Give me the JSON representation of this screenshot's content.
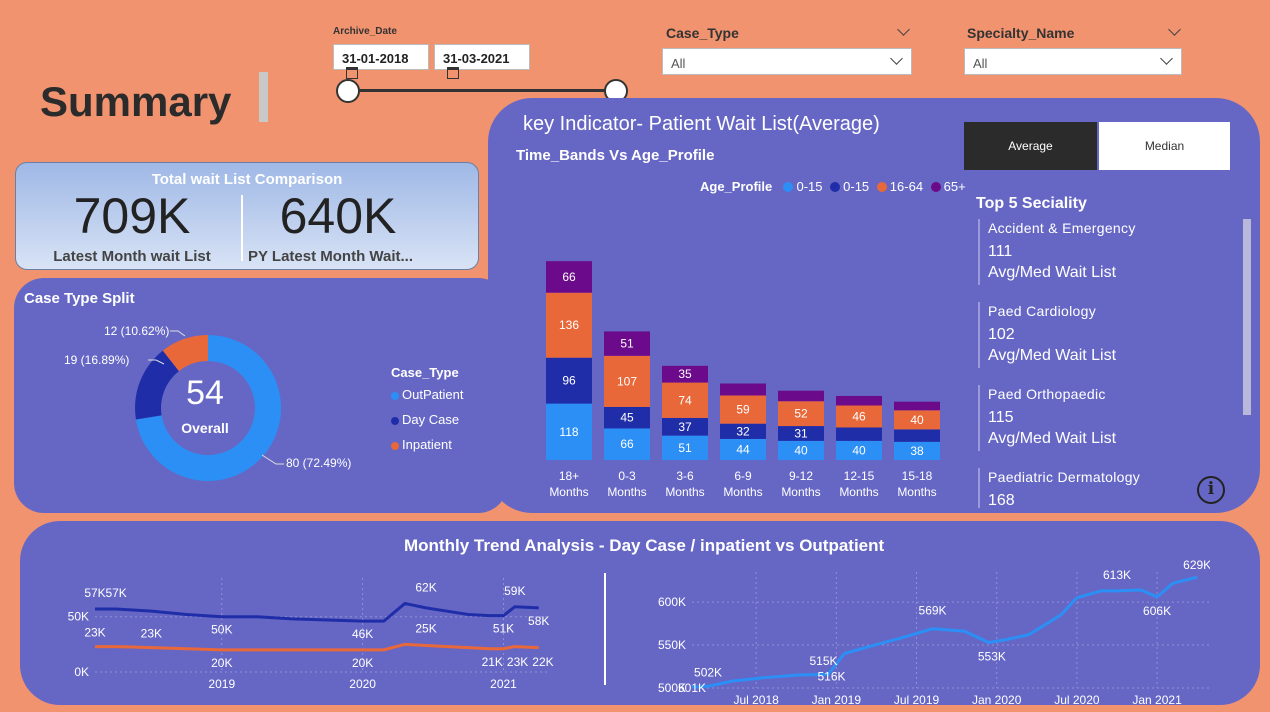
{
  "page_title": "Summary",
  "archive_date": {
    "label": "Archive_Date",
    "start": "31-01-2018",
    "end": "31-03-2021"
  },
  "case_type_filter": {
    "label": "Case_Type",
    "value": "All"
  },
  "specialty_filter": {
    "label": "Specialty_Name",
    "value": "All"
  },
  "wait_comparison": {
    "title": "Total wait List Comparison",
    "latest_value": "709K",
    "latest_label": "Latest Month wait List",
    "py_value": "640K",
    "py_label": "PY Latest Month Wait..."
  },
  "case_split": {
    "title": "Case Type Split",
    "center_value": "54",
    "center_label": "Overall",
    "legend_title": "Case_Type",
    "items": [
      {
        "name": "OutPatient",
        "color": "#2b8ff5",
        "pct": 72.49,
        "label": "80 (72.49%)"
      },
      {
        "name": "Day Case",
        "color": "#1f2ea8",
        "pct": 16.89,
        "label": "19 (16.89%)"
      },
      {
        "name": "Inpatient",
        "color": "#e8683a",
        "pct": 10.62,
        "label": "12 (10.62%)"
      }
    ]
  },
  "key_indicator": {
    "title": "key Indicator- Patient Wait List(Average)",
    "subtitle": "Time_Bands Vs Age_Profile"
  },
  "toggle": {
    "average": "Average",
    "median": "Median"
  },
  "top5": {
    "title": "Top 5 Seciality",
    "items": [
      {
        "name": "Accident & Emergency",
        "value": "111",
        "sub": "Avg/Med Wait List"
      },
      {
        "name": "Paed Cardiology",
        "value": "102",
        "sub": "Avg/Med Wait List"
      },
      {
        "name": "Paed Orthopaedic",
        "value": "115",
        "sub": "Avg/Med Wait List"
      },
      {
        "name": "Paediatric Dermatology",
        "value": "168",
        "sub": ""
      }
    ]
  },
  "trend": {
    "title": "Monthly Trend Analysis - Day Case / inpatient vs Outpatient"
  },
  "chart_data": [
    {
      "type": "bar",
      "title": "Time_Bands Vs Age_Profile",
      "legend_title": "Age_Profile",
      "categories": [
        "18+ Months",
        "0-3 Months",
        "3-6 Months",
        "6-9 Months",
        "9-12 Months",
        "12-15 Months",
        "15-18 Months"
      ],
      "series": [
        {
          "name": "0-15",
          "color": "#2b8ff5",
          "values": [
            118,
            66,
            51,
            44,
            40,
            40,
            38
          ]
        },
        {
          "name": "0-15",
          "color": "#1f2ea8",
          "values": [
            96,
            45,
            37,
            32,
            31,
            28,
            26
          ]
        },
        {
          "name": "16-64",
          "color": "#e8683a",
          "values": [
            136,
            107,
            74,
            59,
            52,
            46,
            40
          ]
        },
        {
          "name": "65+",
          "color": "#6b0a8a",
          "values": [
            66,
            51,
            35,
            25,
            22,
            20,
            18
          ]
        }
      ],
      "data_labels": [
        [
          "118",
          "66",
          "51",
          "44",
          "40",
          "40",
          "38"
        ],
        [
          "96",
          "45",
          "37",
          "32",
          "31",
          "",
          ""
        ],
        [
          "136",
          "107",
          "74",
          "59",
          "52",
          "46",
          "40"
        ],
        [
          "66",
          "51",
          "35",
          "",
          "",
          "",
          ""
        ]
      ],
      "legend_position": "top-right",
      "grid": false
    },
    {
      "type": "line",
      "x_ticks": [
        "2019",
        "2020",
        "2021"
      ],
      "y_ticks": [
        "0K",
        "50K"
      ],
      "ylim": [
        0,
        85
      ],
      "x_range": [
        2018.1,
        2021.33
      ],
      "series": [
        {
          "name": "Day Case",
          "color": "#1f2ea8",
          "x": [
            2018.1,
            2018.25,
            2018.5,
            2018.75,
            2019.0,
            2019.25,
            2019.5,
            2019.75,
            2020.0,
            2020.15,
            2020.3,
            2020.45,
            2020.6,
            2020.75,
            2020.9,
            2021.0,
            2021.08,
            2021.25
          ],
          "y": [
            57,
            57,
            55,
            52,
            50,
            50,
            48,
            47,
            46,
            46,
            62,
            58,
            55,
            52,
            51,
            51,
            59,
            58
          ]
        },
        {
          "name": "Inpatient",
          "color": "#e8683a",
          "x": [
            2018.1,
            2018.25,
            2018.5,
            2018.75,
            2019.0,
            2019.25,
            2019.5,
            2019.75,
            2020.0,
            2020.15,
            2020.3,
            2020.45,
            2020.6,
            2020.75,
            2020.9,
            2021.0,
            2021.08,
            2021.25
          ],
          "y": [
            23,
            23,
            22,
            21,
            20,
            20,
            20,
            20,
            20,
            20,
            25,
            24,
            23,
            22,
            21,
            21,
            23,
            22
          ]
        }
      ],
      "point_labels": [
        {
          "text": "57K",
          "x": 2018.1,
          "y": 57,
          "dy": -12
        },
        {
          "text": "57K",
          "x": 2018.25,
          "y": 57,
          "dy": -12
        },
        {
          "text": "50K",
          "x": 2019.0,
          "y": 50,
          "dy": 17
        },
        {
          "text": "46K",
          "x": 2020.0,
          "y": 46,
          "dy": 17
        },
        {
          "text": "62K",
          "x": 2020.45,
          "y": 62,
          "dy": -12
        },
        {
          "text": "59K",
          "x": 2021.08,
          "y": 59,
          "dy": -12
        },
        {
          "text": "51K",
          "x": 2021.0,
          "y": 51,
          "dy": 17
        },
        {
          "text": "58K",
          "x": 2021.25,
          "y": 58,
          "dy": 17
        },
        {
          "text": "23K",
          "x": 2018.1,
          "y": 23,
          "dy": -10
        },
        {
          "text": "23K",
          "x": 2018.5,
          "y": 22,
          "dy": -10
        },
        {
          "text": "25K",
          "x": 2020.45,
          "y": 25,
          "dy": -12
        },
        {
          "text": "20K",
          "x": 2019.0,
          "y": 20,
          "dy": 17
        },
        {
          "text": "20K",
          "x": 2020.0,
          "y": 20,
          "dy": 17
        },
        {
          "text": "21K",
          "x": 2020.92,
          "y": 21,
          "dy": 17
        },
        {
          "text": "23K",
          "x": 2021.1,
          "y": 21,
          "dy": 17
        },
        {
          "text": "22K",
          "x": 2021.28,
          "y": 21,
          "dy": 17
        }
      ]
    },
    {
      "type": "line",
      "x_ticks": [
        "Jul 2018",
        "Jan 2019",
        "Jul 2019",
        "Jan 2020",
        "Jul 2020",
        "Jan 2021"
      ],
      "y_ticks": [
        "500K",
        "550K",
        "600K"
      ],
      "ylim": [
        500,
        635
      ],
      "x_range": [
        2018.1,
        2021.33
      ],
      "series": [
        {
          "name": "OutPatient",
          "color": "#2b8ff5",
          "x": [
            2018.1,
            2018.2,
            2018.35,
            2018.55,
            2018.75,
            2018.95,
            2019.05,
            2019.2,
            2019.4,
            2019.6,
            2019.8,
            2019.95,
            2020.05,
            2020.2,
            2020.4,
            2020.5,
            2020.65,
            2020.75,
            2020.9,
            2021.0,
            2021.1,
            2021.25
          ],
          "y": [
            501,
            502,
            508,
            512,
            515,
            516,
            540,
            548,
            558,
            569,
            566,
            553,
            556,
            562,
            585,
            605,
            613,
            613,
            614,
            606,
            622,
            629
          ]
        }
      ],
      "point_labels": [
        {
          "text": "502K",
          "x": 2018.2,
          "y": 502,
          "dy": -10
        },
        {
          "text": "501K",
          "x": 2018.1,
          "y": 501,
          "dy": 5
        },
        {
          "text": "515K",
          "x": 2018.92,
          "y": 515,
          "dy": -10
        },
        {
          "text": "516K",
          "x": 2018.97,
          "y": 516,
          "dy": 6
        },
        {
          "text": "569K",
          "x": 2019.6,
          "y": 569,
          "dy": -14
        },
        {
          "text": "553K",
          "x": 2019.97,
          "y": 553,
          "dy": 18
        },
        {
          "text": "613K",
          "x": 2020.75,
          "y": 613,
          "dy": -12
        },
        {
          "text": "606K",
          "x": 2021.0,
          "y": 606,
          "dy": 18
        },
        {
          "text": "629K",
          "x": 2021.25,
          "y": 629,
          "dy": -8
        }
      ]
    }
  ]
}
